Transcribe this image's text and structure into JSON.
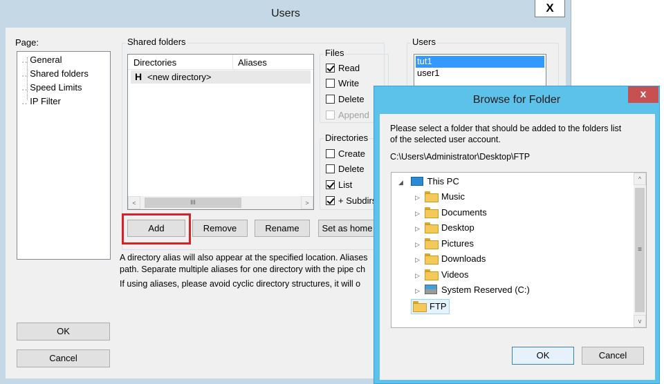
{
  "users_dialog": {
    "title": "Users",
    "close_glyph": "X",
    "page_label": "Page:",
    "pages": [
      "General",
      "Shared folders",
      "Speed Limits",
      "IP Filter"
    ],
    "shared_folders": {
      "title": "Shared folders",
      "columns": [
        "Directories",
        "Aliases"
      ],
      "rows": [
        {
          "marker": "H",
          "directory": "<new directory>"
        }
      ],
      "hscroll_thumb": "III",
      "buttons": {
        "add": "Add",
        "remove": "Remove",
        "rename": "Rename",
        "set_home": "Set as home"
      }
    },
    "files": {
      "title": "Files",
      "read": {
        "label": "Read",
        "checked": true
      },
      "write": {
        "label": "Write",
        "checked": false
      },
      "delete": {
        "label": "Delete",
        "checked": false
      },
      "append": {
        "label": "Append",
        "checked": false,
        "disabled": true
      }
    },
    "directories": {
      "title": "Directories",
      "create": {
        "label": "Create",
        "checked": false
      },
      "delete": {
        "label": "Delete",
        "checked": false
      },
      "list": {
        "label": "List",
        "checked": true
      },
      "subdirs": {
        "label": "+ Subdirs",
        "checked": true
      }
    },
    "users_group": {
      "title": "Users",
      "items": [
        "tut1",
        "user1"
      ],
      "selected_index": 0
    },
    "info_line1": "A directory alias will also appear at the specified location. Aliases",
    "info_line2": "path. Separate multiple aliases for one directory with the pipe ch",
    "info_line3": "If using aliases, please avoid cyclic directory structures, it will o",
    "ok": "OK",
    "cancel": "Cancel",
    "highlight_color": "#d9202a"
  },
  "browse_dialog": {
    "title": "Browse for Folder",
    "close_glyph": "x",
    "instruction_line1": "Please select a folder that should be added to the folders list",
    "instruction_line2": "of the selected user account.",
    "path": "C:\\Users\\Administrator\\Desktop\\FTP",
    "tree": {
      "root": "This PC",
      "children": [
        "Music",
        "Documents",
        "Desktop",
        "Pictures",
        "Downloads",
        "Videos",
        "System Reserved (C:)"
      ],
      "selected": "FTP"
    },
    "ok": "OK",
    "cancel": "Cancel",
    "accent_color": "#5cc2ea",
    "close_color": "#c75050"
  }
}
